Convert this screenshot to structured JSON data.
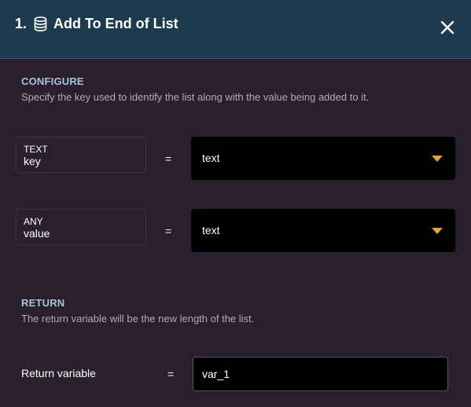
{
  "header": {
    "number": "1.",
    "icon": "database-icon",
    "title": "Add To End of List",
    "close_icon": "close-icon"
  },
  "configure": {
    "title": "CONFIGURE",
    "description": "Specify the key used to identify the list along with the value being added to it."
  },
  "arguments": [
    {
      "type": "TEXT",
      "name": "key",
      "operator": "=",
      "value": "text"
    },
    {
      "type": "ANY",
      "name": "value",
      "operator": "=",
      "value": "text"
    }
  ],
  "return": {
    "title": "RETURN",
    "description": "The return variable will be the new length of the list.",
    "label": "Return variable",
    "operator": "=",
    "value": "var_1"
  },
  "colors": {
    "header_bg": "#1e3a4f",
    "panel_bg": "#2a1f2d",
    "section_title": "#a9c3dc",
    "dropdown_arrow": "#e0a53a"
  }
}
